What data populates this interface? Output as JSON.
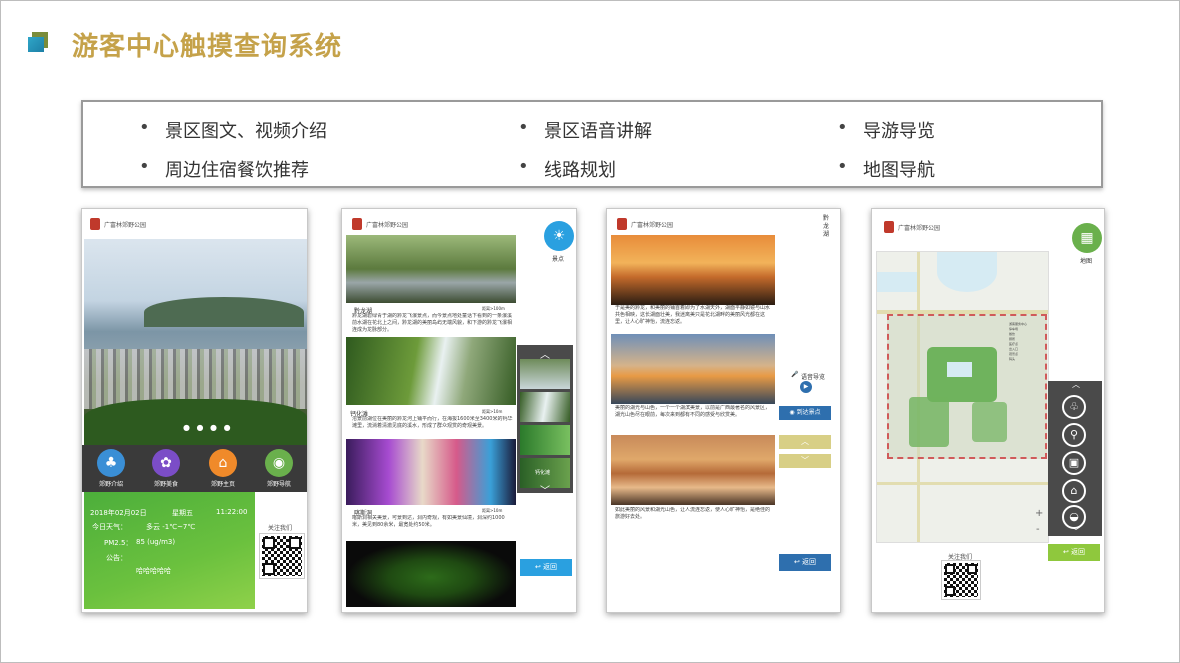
{
  "title": "游客中心触摸查询系统",
  "features": [
    "景区图文、视频介绍",
    "景区语音讲解",
    "导游导览",
    "周边住宿餐饮推荐",
    "线路规划",
    "地图导航"
  ],
  "park_name": "广富林郊野公园",
  "colors": {
    "title": "#c5a24a",
    "accent_blue": "#2e6fae",
    "green": "#6bc13e",
    "tan": "#d8cf86"
  },
  "panel1": {
    "dots": "● ● ● ●",
    "menu": [
      {
        "label": "郊野介绍",
        "icon": "tree-icon",
        "color": "#3a8fd6"
      },
      {
        "label": "郊野美食",
        "icon": "food-icon",
        "color": "#7b4dc7"
      },
      {
        "label": "郊野主页",
        "icon": "home-icon",
        "color": "#f08a2a"
      },
      {
        "label": "郊野导航",
        "icon": "location-icon",
        "color": "#6ab04c"
      }
    ],
    "info": {
      "date": "2018年02月02日",
      "weekday": "星期五",
      "time": "11:22:00",
      "weather_label": "今日天气：",
      "weather_value": "多云 -1℃~7℃",
      "pm_label": "PM2.5：",
      "pm_value": "85 (ug/m3)",
      "notice_label": "公告：",
      "notice_value": "哈哈哈哈哈"
    },
    "qr_label": "关注我们"
  },
  "panel2": {
    "spot_button_label": "景点",
    "items": [
      {
        "name": "黔龙湖",
        "distance": "距离>100m",
        "text": "黔龙湖碧绿青于湖的黔龙飞瀑景点，而今景点地处童话下看到的一条瀑溪前水湖在花北上之间，黔龙湖的美丽岛屿无端风貌，和下游的黔龙飞瀑相连成为龙脉部分。"
      },
      {
        "name": "钙化滩",
        "distance": "距离>10m",
        "text": "溶景前湖位在美丽的黔龙河上铺平而行，在海拔1600米至3400米的钙华滩里，流淌着清澈见底的溪水，形成了群众观赏的奇观美景。"
      },
      {
        "name": "喀斯洞",
        "distance": "距离>10m",
        "text": "喀斯洞相关美景，可景到达，洞内奇观，有如美景仙境，洞深约1000米，美见到80余米，最宽处约50米。"
      }
    ],
    "thumb_caption": "钙化滩",
    "back_label": "返回"
  },
  "panel3": {
    "title_vertical": "黔龙湖",
    "texts": [
      "于是美的黔龙，和美丽的铺首着即为了水湖天外，湖面平静如镜与山水共色相映，这长湖面壮美，我迷离美只是花北湖畔的美丽风光都在这里，让人心旷神怡，流连忘返。",
      "美丽的湖光与山色，一个一个湖滨美景，以前是广西最著名的风景区，湖光山色尽在眼前，每次来到都有不同的感受与欣赏美。",
      "如此美丽的风景和湖光山色，让人流连忘返，使人心旷神怡，是绝佳的旅游好去处。"
    ],
    "voice_label": "语音导览",
    "arrive_label": "到达景点",
    "back_label": "返回"
  },
  "panel4": {
    "map_button_label": "地图",
    "legend": [
      "游客服务中心",
      "停车场",
      "餐饮",
      "厕所",
      "医疗点",
      "出入口",
      "观景点",
      "码头"
    ],
    "back_label": "返回",
    "qr_label": "关注我们"
  }
}
